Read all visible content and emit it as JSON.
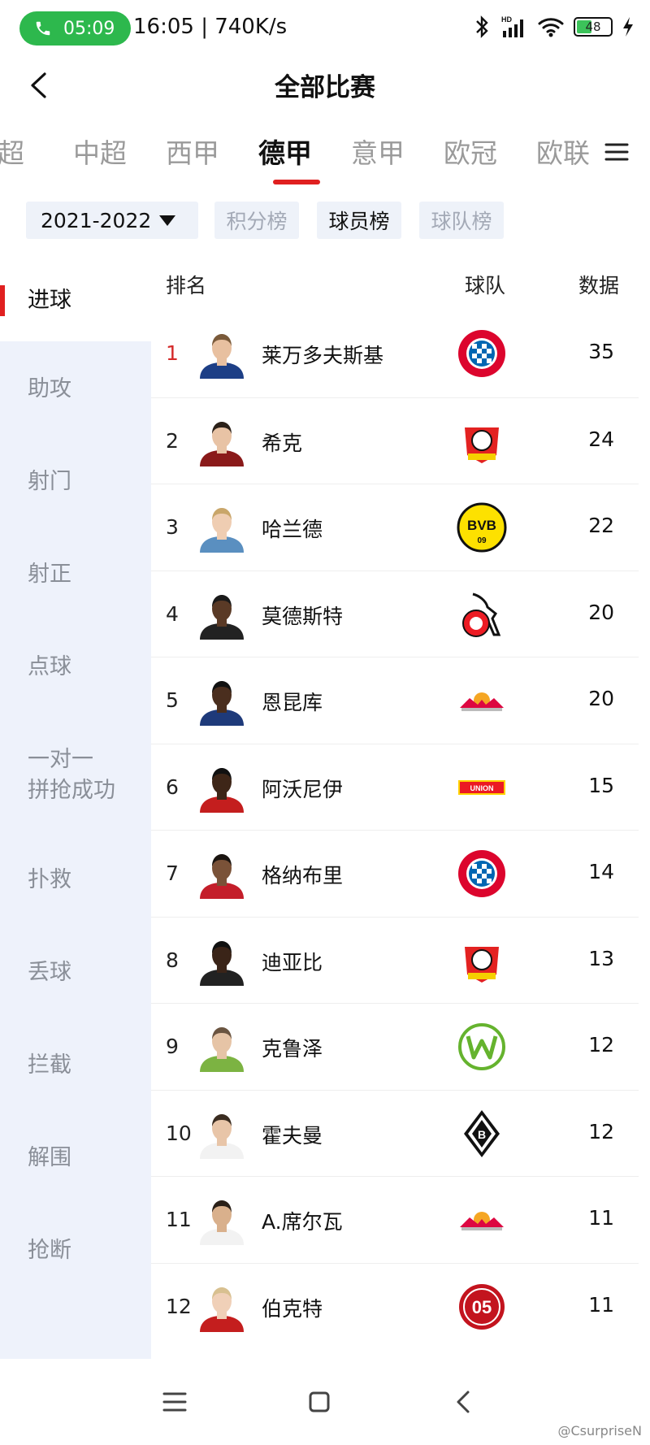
{
  "status_bar": {
    "call_time": "05:09",
    "info": "16:05 | 740K/s",
    "battery": "48",
    "hd_label": "HD"
  },
  "header": {
    "title": "全部比赛"
  },
  "league_tabs": [
    {
      "label": "英超",
      "active": false
    },
    {
      "label": "中超",
      "active": false
    },
    {
      "label": "西甲",
      "active": false
    },
    {
      "label": "德甲",
      "active": true
    },
    {
      "label": "意甲",
      "active": false
    },
    {
      "label": "欧冠",
      "active": false
    },
    {
      "label": "欧联",
      "active": false
    }
  ],
  "filters": {
    "season": "2021-2022",
    "buttons": [
      {
        "label": "积分榜",
        "active": false
      },
      {
        "label": "球员榜",
        "active": true
      },
      {
        "label": "球队榜",
        "active": false
      }
    ]
  },
  "categories": [
    {
      "label": "进球",
      "active": true
    },
    {
      "label": "助攻",
      "active": false
    },
    {
      "label": "射门",
      "active": false
    },
    {
      "label": "射正",
      "active": false
    },
    {
      "label": "点球",
      "active": false
    },
    {
      "label": "一对一\n拼抢成功",
      "active": false
    },
    {
      "label": "扑救",
      "active": false
    },
    {
      "label": "丢球",
      "active": false
    },
    {
      "label": "拦截",
      "active": false
    },
    {
      "label": "解围",
      "active": false
    },
    {
      "label": "抢断",
      "active": false
    }
  ],
  "table": {
    "headers": {
      "rank": "排名",
      "team": "球队",
      "data": "数据"
    },
    "rows": [
      {
        "rank": "1",
        "name": "莱万多夫斯基",
        "team": "bayern",
        "value": "35",
        "kit": "#1d3f86",
        "skin": "#e8c0a0",
        "hair": "#7a5a3a"
      },
      {
        "rank": "2",
        "name": "希克",
        "team": "leverkusen",
        "value": "24",
        "kit": "#8a1a1a",
        "skin": "#e8c3a5",
        "hair": "#2b2119"
      },
      {
        "rank": "3",
        "name": "哈兰德",
        "team": "dortmund",
        "value": "22",
        "kit": "#5a8fc0",
        "skin": "#efcdb2",
        "hair": "#c9a66a"
      },
      {
        "rank": "4",
        "name": "莫德斯特",
        "team": "koeln",
        "value": "20",
        "kit": "#222222",
        "skin": "#5a3a26",
        "hair": "#1a1a1a"
      },
      {
        "rank": "5",
        "name": "恩昆库",
        "team": "leipzig",
        "value": "20",
        "kit": "#1e3a7a",
        "skin": "#4a2e1e",
        "hair": "#111111"
      },
      {
        "rank": "6",
        "name": "阿沃尼伊",
        "team": "union",
        "value": "15",
        "kit": "#c41e1e",
        "skin": "#3e2618",
        "hair": "#111111"
      },
      {
        "rank": "7",
        "name": "格纳布里",
        "team": "bayern",
        "value": "14",
        "kit": "#c41e2a",
        "skin": "#7a5238",
        "hair": "#1a1410"
      },
      {
        "rank": "8",
        "name": "迪亚比",
        "team": "leverkusen",
        "value": "13",
        "kit": "#222222",
        "skin": "#3a2418",
        "hair": "#111111"
      },
      {
        "rank": "9",
        "name": "克鲁泽",
        "team": "wolfsburg",
        "value": "12",
        "kit": "#7cb342",
        "skin": "#e6c4a6",
        "hair": "#6a5440"
      },
      {
        "rank": "10",
        "name": "霍夫曼",
        "team": "gladbach",
        "value": "12",
        "kit": "#f2f2f2",
        "skin": "#e8c5a8",
        "hair": "#3a2c20"
      },
      {
        "rank": "11",
        "name": "A.席尔瓦",
        "team": "leipzig",
        "value": "11",
        "kit": "#f2f2f2",
        "skin": "#d9b08c",
        "hair": "#2a2018"
      },
      {
        "rank": "12",
        "name": "伯克特",
        "team": "mainz",
        "value": "11",
        "kit": "#c41e1e",
        "skin": "#f0d0b8",
        "hair": "#d8c090"
      }
    ]
  },
  "team_badges": {
    "bayern": {
      "text": "FC BAYERN MÜNCHEN",
      "color": "#dc052d",
      "accent": "#0066b2"
    },
    "leverkusen": {
      "text": "BAYER",
      "color": "#e32221",
      "accent": "#111111"
    },
    "dortmund": {
      "text": "BVB 09",
      "color": "#fde100",
      "accent": "#111111"
    },
    "koeln": {
      "text": "1.FC KÖLN",
      "color": "#ed1c24",
      "accent": "#111111"
    },
    "leipzig": {
      "text": "RB",
      "color": "#dd0741",
      "accent": "#f5a623"
    },
    "union": {
      "text": "1.FC UNION",
      "color": "#eb1923",
      "accent": "#ffd200"
    },
    "wolfsburg": {
      "text": "W",
      "color": "#65b32e",
      "accent": "#ffffff"
    },
    "gladbach": {
      "text": "B",
      "color": "#111111",
      "accent": "#ffffff"
    },
    "mainz": {
      "text": "05",
      "color": "#c3141e",
      "accent": "#ffffff"
    }
  },
  "watermark": "@CsurpriseN",
  "colors": {
    "accent": "#e02020",
    "sidebar_bg": "#eef2fb",
    "call_green": "#2db84d"
  }
}
